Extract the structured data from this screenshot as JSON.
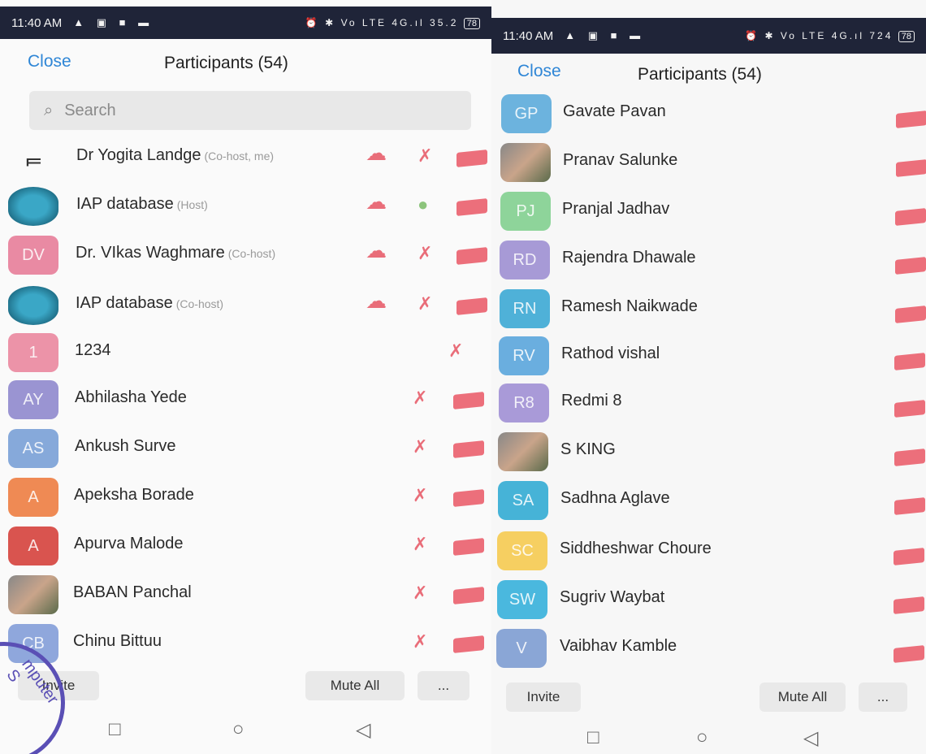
{
  "left": {
    "status": {
      "time": "11:40 AM",
      "icons_left": "▲ ▣ ■ ▬",
      "icons_right": "⏰ ✱ Vo LTE 4G.ıl 35.2",
      "battery": "78"
    },
    "header": {
      "close": "Close",
      "title": "Participants (54)"
    },
    "search": {
      "placeholder": "Search"
    },
    "participants": [
      {
        "name": "Dr Yogita Landge",
        "role": "(Co-host, me)",
        "initials": "",
        "avatar": "gun",
        "color": "",
        "cloud": true,
        "mic": "muted",
        "cam": true
      },
      {
        "name": "IAP database",
        "role": "(Host)",
        "initials": "",
        "avatar": "teal",
        "color": "",
        "cloud": true,
        "mic": "on",
        "cam": true
      },
      {
        "name": "Dr. VIkas Waghmare",
        "role": "(Co-host)",
        "initials": "DV",
        "avatar": "initials",
        "color": "#e98aa3",
        "cloud": true,
        "mic": "muted",
        "cam": true
      },
      {
        "name": "IAP database",
        "role": "(Co-host)",
        "initials": "",
        "avatar": "teal",
        "color": "",
        "cloud": true,
        "mic": "muted",
        "cam": true
      },
      {
        "name": "1234",
        "role": "",
        "initials": "1",
        "avatar": "initials",
        "color": "#ec93a8",
        "cloud": false,
        "mic": "muted",
        "cam": false
      },
      {
        "name": "Abhilasha Yede",
        "role": "",
        "initials": "AY",
        "avatar": "initials",
        "color": "#9a94d2",
        "cloud": false,
        "mic": "muted",
        "cam": true
      },
      {
        "name": "Ankush Surve",
        "role": "",
        "initials": "AS",
        "avatar": "initials",
        "color": "#86a9da",
        "cloud": false,
        "mic": "muted",
        "cam": true
      },
      {
        "name": "Apeksha Borade",
        "role": "",
        "initials": "A",
        "avatar": "initials",
        "color": "#ef8a54",
        "cloud": false,
        "mic": "muted",
        "cam": true
      },
      {
        "name": "Apurva Malode",
        "role": "",
        "initials": "A",
        "avatar": "initials",
        "color": "#d9544f",
        "cloud": false,
        "mic": "muted",
        "cam": true
      },
      {
        "name": "BABAN Panchal",
        "role": "",
        "initials": "",
        "avatar": "photo",
        "color": "",
        "cloud": false,
        "mic": "muted",
        "cam": true
      },
      {
        "name": "Chinu Bittuu",
        "role": "",
        "initials": "CB",
        "avatar": "initials",
        "color": "#8fa7dc",
        "cloud": false,
        "mic": "muted",
        "cam": true
      }
    ],
    "bottom": {
      "invite": "Invite",
      "mute_all": "Mute All",
      "more": "..."
    },
    "stamp_text": "mputer S"
  },
  "right": {
    "status": {
      "time": "11:40 AM",
      "icons_left": "▲ ▣ ■ ▬",
      "icons_right": "⏰ ✱ Vo LTE 4G.ıl 724",
      "battery": "78"
    },
    "header": {
      "close": "Close",
      "title": "Participants (54)"
    },
    "participants": [
      {
        "name": "Gavate Pavan",
        "initials": "GP",
        "avatar": "initials",
        "color": "#6cb3de"
      },
      {
        "name": "Pranav Salunke",
        "initials": "",
        "avatar": "photo",
        "color": ""
      },
      {
        "name": "Pranjal Jadhav",
        "initials": "PJ",
        "avatar": "initials",
        "color": "#8ed49a"
      },
      {
        "name": "Rajendra Dhawale",
        "initials": "RD",
        "avatar": "initials",
        "color": "#a79ad6"
      },
      {
        "name": "Ramesh Naikwade",
        "initials": "RN",
        "avatar": "initials",
        "color": "#4fb1d8"
      },
      {
        "name": "Rathod vishal",
        "initials": "RV",
        "avatar": "initials",
        "color": "#6aaedf"
      },
      {
        "name": "Redmi 8",
        "initials": "R8",
        "avatar": "initials",
        "color": "#a99ad8"
      },
      {
        "name": "S KING",
        "initials": "",
        "avatar": "photo",
        "color": ""
      },
      {
        "name": "Sadhna Aglave",
        "initials": "SA",
        "avatar": "initials",
        "color": "#46b3d7"
      },
      {
        "name": "Siddheshwar Choure",
        "initials": "SC",
        "avatar": "initials",
        "color": "#f6cf61"
      },
      {
        "name": "Sugriv Waybat",
        "initials": "SW",
        "avatar": "initials",
        "color": "#4ab8de"
      },
      {
        "name": "Vaibhav Kamble",
        "initials": "V",
        "avatar": "initials",
        "color": "#8aa6d6"
      }
    ],
    "bottom": {
      "invite": "Invite",
      "mute_all": "Mute All",
      "more": "..."
    }
  },
  "nav": {
    "square": "□",
    "circle": "○",
    "back": "◁"
  },
  "colors": {
    "accent": "#2f86d6",
    "muted_icon": "#e96d79",
    "mic_on": "#8cc47c"
  }
}
